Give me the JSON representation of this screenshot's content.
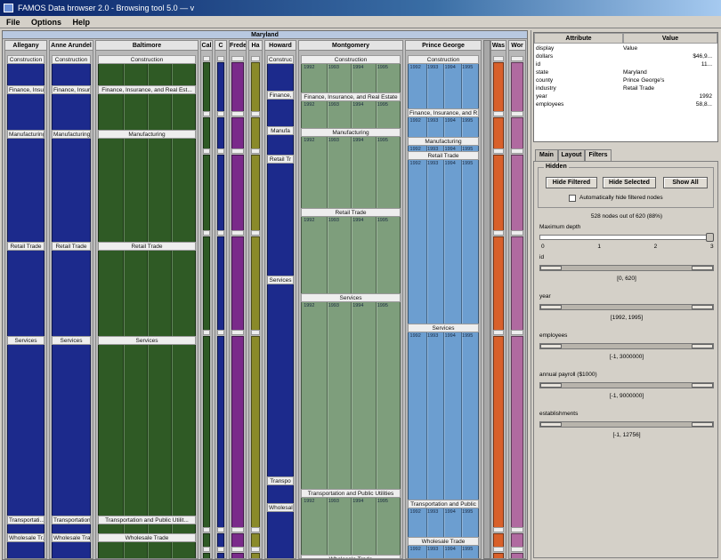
{
  "window": {
    "title": "FAMOS Data browser 2.0 - Browsing tool 5.0 — v"
  },
  "menu": [
    "File",
    "Options",
    "Help"
  ],
  "viz": {
    "root_label": "Maryland",
    "columns": [
      {
        "header": "Allegany",
        "labels": [
          "Construction",
          "Finance, Insur...",
          "Manufacturing",
          "Retail Trade",
          "Services",
          "Transportati...",
          "Wholesale Tr..."
        ]
      },
      {
        "header": "Anne Arundel",
        "labels": [
          "Construction",
          "Finance, Insura...",
          "Manufacturing",
          "Retail Trade",
          "Services",
          "Transportation",
          "Wholesale Trad..."
        ]
      },
      {
        "header": "Baltimore",
        "labels": [
          "Construction",
          "Finance, Insurance, and Real Est...",
          "Manufacturing",
          "Retail Trade",
          "Services",
          "Transportation and Public Utilit...",
          "Wholesale Trade"
        ]
      },
      {
        "header": "Cal"
      },
      {
        "header": "C"
      },
      {
        "header": "Frede"
      },
      {
        "header": "Ha"
      },
      {
        "header": "Howard",
        "labels": [
          "Construc",
          "Finance,",
          "Manufa",
          "Retail Tr",
          "Services",
          "Transpo",
          "Wholesal"
        ]
      },
      {
        "header": "Montgomery",
        "labels": [
          "Construction",
          "Finance, Insurance, and Real Estate",
          "Manufacturing",
          "Retail Trade",
          "Services",
          "Transportation and Public Utilities",
          "Wholesale Trade"
        ]
      },
      {
        "header": "Prince George",
        "labels": [
          "Construction",
          "Finance, Insurance, and R...",
          "Manufacturing",
          "Retail Trade",
          "Services",
          "Transportation and Public",
          "Wholesale Trade"
        ]
      },
      {
        "header": "Was"
      },
      {
        "header": "Wor"
      }
    ],
    "year_cells": [
      "1992",
      "1993",
      "1994",
      "1995"
    ]
  },
  "panel": {
    "attributes_table": {
      "columns": [
        "Attribute",
        "Value"
      ],
      "rows": [
        {
          "key": "display",
          "value": "Value"
        },
        {
          "key": "dollars",
          "value": "$46,9..."
        },
        {
          "key": "id",
          "value": "11..."
        },
        {
          "key": "state",
          "value": "Maryland"
        },
        {
          "key": "county",
          "value": "Prince George's"
        },
        {
          "key": "industry",
          "value": "Retail Trade"
        },
        {
          "key": "year",
          "value": "1992"
        },
        {
          "key": "employees",
          "value": "58,8..."
        }
      ]
    },
    "tabs": [
      "Main",
      "Layout",
      "Filters"
    ],
    "active_tab": "Filters",
    "hidden_group": {
      "label": "Hidden",
      "buttons": [
        "Hide Filtered",
        "Hide Selected",
        "Show All"
      ],
      "checkbox_label": "Automatically hide filtered nodes",
      "checkbox_checked": false
    },
    "count_text": "528 nodes out of 620 (88%)",
    "depth_filter": {
      "label": "Maximum depth",
      "ticks": [
        "0",
        "1",
        "2",
        "3"
      ],
      "value_fraction": 1.0
    },
    "range_filters": [
      {
        "label": "id",
        "range_text": "[0, 620]",
        "lo": 0.0,
        "hi": 1.0
      },
      {
        "label": "year",
        "range_text": "[1992, 1995]",
        "lo": 0.0,
        "hi": 1.0
      },
      {
        "label": "employees",
        "range_text": "[-1, 3000000]",
        "lo": 0.0,
        "hi": 1.0
      },
      {
        "label": "annual payroll ($1000)",
        "range_text": "[-1, 9000000]",
        "lo": 0.0,
        "hi": 1.0
      },
      {
        "label": "establishments",
        "range_text": "[-1, 12756]",
        "lo": 0.0,
        "hi": 1.0
      }
    ]
  },
  "colors": {
    "county_blue": "#1c2a8c",
    "industry_green": "#2f5a25",
    "light_green": "#7e9e7c",
    "light_blue": "#6c9ed0",
    "purple": "#7a2a8a",
    "orange": "#d8602a",
    "titlebar": "#0a246a"
  }
}
